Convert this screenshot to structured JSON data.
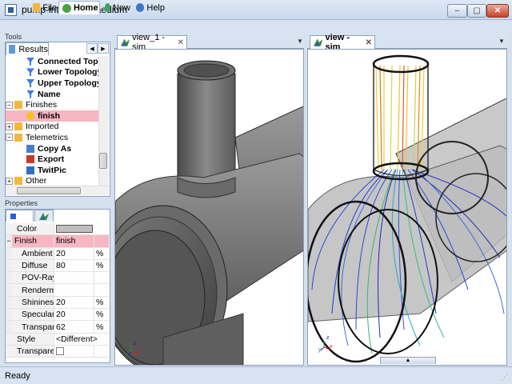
{
  "window": {
    "title": "pump-internal - Caedium",
    "minimize": "–",
    "maximize": "▢",
    "close": "✕"
  },
  "menu": {
    "file": "File",
    "home": "Home",
    "new": "New",
    "help": "Help"
  },
  "tools": {
    "header": "Tools",
    "results_tab": "Results",
    "tree": [
      {
        "label": "Connected Topolo",
        "bold": true,
        "icon": "filter-icon"
      },
      {
        "label": "Lower Topology",
        "bold": true,
        "icon": "filter-icon"
      },
      {
        "label": "Upper Topology",
        "bold": true,
        "icon": "filter-icon"
      },
      {
        "label": "Name",
        "bold": true,
        "icon": "filter-icon"
      },
      {
        "label": "Finishes",
        "bold": false,
        "icon": "folder-icon",
        "expander": "−"
      },
      {
        "label": "finish",
        "bold": true,
        "icon": "finish-icon",
        "selected": true
      },
      {
        "label": "Imported",
        "bold": false,
        "icon": "folder-icon",
        "expander": "+"
      },
      {
        "label": "Telemetrics",
        "bold": false,
        "icon": "folder-icon",
        "expander": "−"
      },
      {
        "label": "Copy As",
        "bold": true,
        "icon": "copy-icon"
      },
      {
        "label": "Export",
        "bold": true,
        "icon": "export-icon"
      },
      {
        "label": "TwitPic",
        "bold": true,
        "icon": "twitpic-icon"
      },
      {
        "label": "Other",
        "bold": false,
        "icon": "folder-icon",
        "expander": "+"
      }
    ]
  },
  "properties": {
    "header": "Properties",
    "rows": [
      {
        "name": "Color",
        "value": "",
        "unit": "",
        "kind": "swatch",
        "level": "top"
      },
      {
        "name": "Finish",
        "value": "finish",
        "unit": "",
        "kind": "text",
        "level": "group",
        "highlight": true
      },
      {
        "name": "Ambient",
        "value": "20",
        "unit": "%",
        "kind": "text",
        "level": "sub"
      },
      {
        "name": "Diffuse",
        "value": "80",
        "unit": "%",
        "kind": "text",
        "level": "sub"
      },
      {
        "name": "POV-Ray",
        "value": "",
        "unit": "",
        "kind": "text",
        "level": "sub"
      },
      {
        "name": "Renderman",
        "value": "",
        "unit": "",
        "kind": "text",
        "level": "sub"
      },
      {
        "name": "Shininess",
        "value": "20",
        "unit": "%",
        "kind": "text",
        "level": "sub"
      },
      {
        "name": "Specular",
        "value": "20",
        "unit": "%",
        "kind": "text",
        "level": "sub"
      },
      {
        "name": "Transpare",
        "value": "62",
        "unit": "%",
        "kind": "text",
        "level": "sub"
      },
      {
        "name": "Style",
        "value": "<Different>",
        "unit": "",
        "kind": "dropdown",
        "level": "top"
      },
      {
        "name": "Transparent",
        "value": "",
        "unit": "",
        "kind": "checkbox",
        "level": "top"
      }
    ]
  },
  "views": [
    {
      "tab": "view_1 - sim",
      "close": "✕",
      "axes": {
        "x": "x",
        "y": "y",
        "z": "z"
      }
    },
    {
      "tab": "view - sim",
      "close": "✕",
      "axes": {
        "x": "x",
        "y": "y",
        "z": "z"
      }
    }
  ],
  "status": "Ready",
  "colors": {
    "selection": "#f6b6c2",
    "chrome": "#d7e3f1",
    "accent": "#2d5e9e"
  }
}
